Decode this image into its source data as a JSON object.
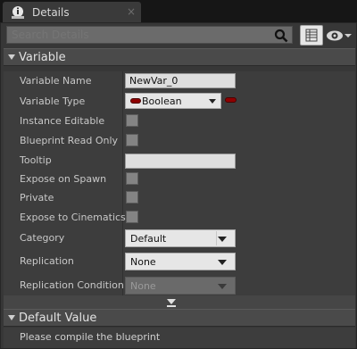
{
  "tab": {
    "title": "Details",
    "close_glyph": "×",
    "icon": "details-info-icon"
  },
  "search": {
    "placeholder": "Search Details",
    "value": ""
  },
  "toolbar": {
    "view_options_icon": "grid-view-icon",
    "visibility_icon": "eye-icon"
  },
  "variable_section": {
    "title": "Variable",
    "rows": [
      {
        "label": "Variable Name",
        "value": "NewVar_0"
      },
      {
        "label": "Variable Type",
        "value": "Boolean"
      },
      {
        "label": "Instance Editable",
        "checked": false
      },
      {
        "label": "Blueprint Read Only",
        "checked": false
      },
      {
        "label": "Tooltip",
        "value": ""
      },
      {
        "label": "Expose on Spawn",
        "checked": false
      },
      {
        "label": "Private",
        "checked": false
      },
      {
        "label": "Expose to Cinematics",
        "checked": false
      },
      {
        "label": "Category",
        "value": "Default"
      },
      {
        "label": "Replication",
        "value": "None"
      },
      {
        "label": "Replication Condition",
        "value": "None",
        "disabled": true
      }
    ]
  },
  "default_value_section": {
    "title": "Default Value",
    "message": "Please compile the blueprint"
  },
  "colors": {
    "boolean_pin": "#8f0000",
    "panel_bg": "#373737"
  }
}
